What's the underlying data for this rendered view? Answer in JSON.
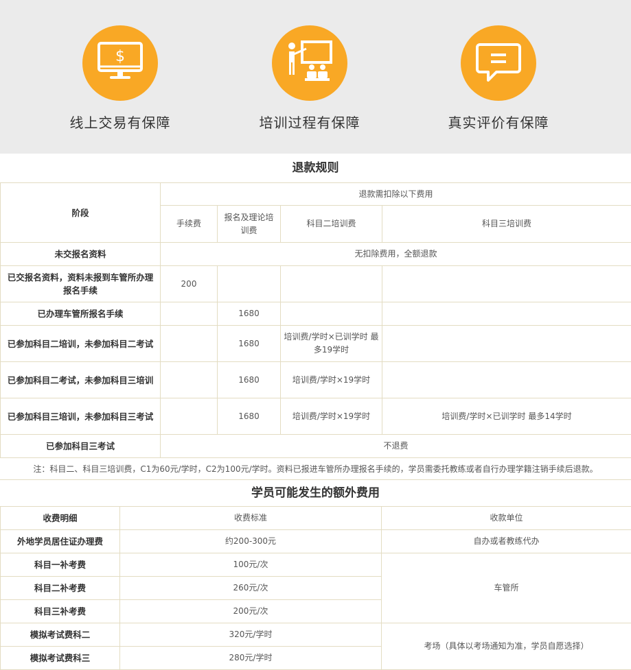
{
  "guarantees": [
    {
      "label": "线上交易有保障",
      "icon": "monitor-dollar-icon"
    },
    {
      "label": "培训过程有保障",
      "icon": "teacher-board-icon"
    },
    {
      "label": "真实评价有保障",
      "icon": "speech-bubble-icon"
    }
  ],
  "colors": {
    "accent": "#f9a825",
    "banner_bg": "#ebebeb",
    "border": "#e3dcc2"
  },
  "refund": {
    "title": "退款规则",
    "header": {
      "stage": "阶段",
      "deduct": "退款需扣除以下费用",
      "fee": "手续费",
      "reg": "报名及理论培训费",
      "k2": "科目二培训费",
      "k3": "科目三培训费"
    },
    "rows": [
      {
        "stage": "未交报名资料",
        "span": "无扣除费用，全额退款"
      },
      {
        "stage": "已交报名资料，资料未报到车管所办理报名手续",
        "fee": "200",
        "reg": "",
        "k2": "",
        "k3": ""
      },
      {
        "stage": "已办理车管所报名手续",
        "fee": "",
        "reg": "1680",
        "k2": "",
        "k3": ""
      },
      {
        "stage": "已参加科目二培训，未参加科目二考试",
        "fee": "",
        "reg": "1680",
        "k2": "培训费/学时×已训学时 最多19学时",
        "k3": ""
      },
      {
        "stage": "已参加科目二考试，未参加科目三培训",
        "fee": "",
        "reg": "1680",
        "k2": "培训费/学时×19学时",
        "k3": ""
      },
      {
        "stage": "已参加科目三培训，未参加科目三考试",
        "fee": "",
        "reg": "1680",
        "k2": "培训费/学时×19学时",
        "k3": "培训费/学时×已训学时 最多14学时"
      },
      {
        "stage": "已参加科目三考试",
        "span": "不退费"
      }
    ],
    "note": "注：科目二、科目三培训费，C1为60元/学时，C2为100元/学时。资料已报进车管所办理报名手续的，学员需委托教练或者自行办理学籍注销手续后退款。"
  },
  "extra": {
    "title": "学员可能发生的额外费用",
    "header": {
      "item": "收费明细",
      "standard": "收费标准",
      "unit": "收款单位"
    },
    "rows": [
      {
        "item": "外地学员居住证办理费",
        "standard": "约200-300元"
      },
      {
        "item": "科目一补考费",
        "standard": "100元/次"
      },
      {
        "item": "科目二补考费",
        "standard": "260元/次"
      },
      {
        "item": "科目三补考费",
        "standard": "200元/次"
      },
      {
        "item": "模拟考试费科二",
        "standard": "320元/学时"
      },
      {
        "item": "模拟考试费科三",
        "standard": "280元/学时"
      }
    ],
    "units": {
      "residence": "自办或者教练代办",
      "dmv": "车管所",
      "exam_site": "考场（具体以考场通知为准，学员自愿选择）"
    }
  }
}
